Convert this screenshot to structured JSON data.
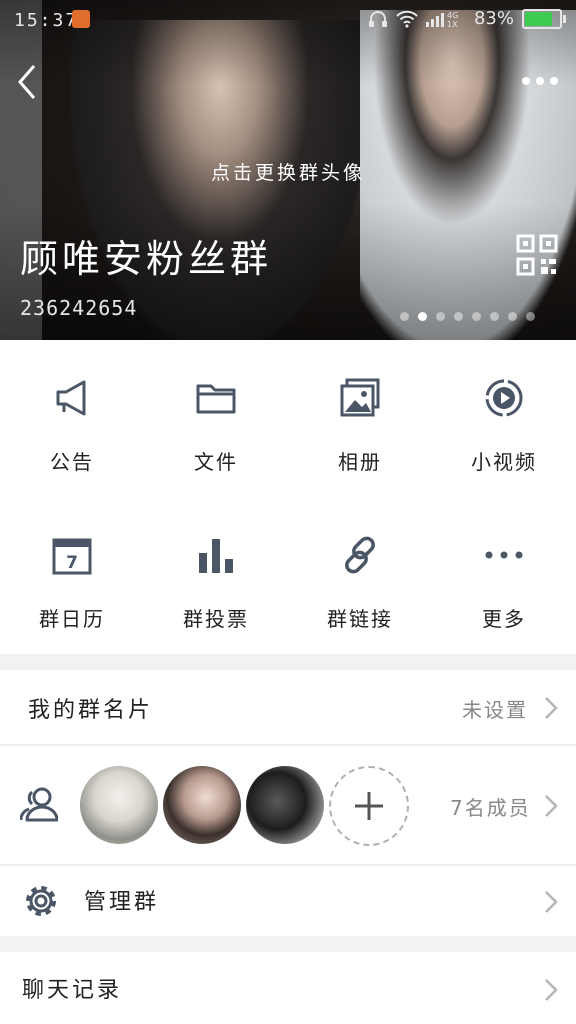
{
  "status": {
    "time": "15:37",
    "battery": "83%",
    "signal_top": "4G",
    "signal_bottom": "1X"
  },
  "header": {
    "change_avatar_hint": "点击更换群头像",
    "group_name": "顾唯安粉丝群",
    "group_id": "236242654",
    "carousel_active_index": 1,
    "carousel_count": 8
  },
  "grid": [
    {
      "label": "公告",
      "icon": "megaphone-icon"
    },
    {
      "label": "文件",
      "icon": "folder-icon"
    },
    {
      "label": "相册",
      "icon": "photo-album-icon"
    },
    {
      "label": "小视频",
      "icon": "video-icon"
    },
    {
      "label": "群日历",
      "icon": "calendar-icon",
      "day": "7"
    },
    {
      "label": "群投票",
      "icon": "bar-chart-icon"
    },
    {
      "label": "群链接",
      "icon": "link-icon"
    },
    {
      "label": "更多",
      "icon": "more-dots-icon"
    }
  ],
  "card": {
    "title": "我的群名片",
    "value": "未设置"
  },
  "members": {
    "count_text": "7名成员"
  },
  "manage": {
    "title": "管理群"
  },
  "history": {
    "title": "聊天记录"
  }
}
